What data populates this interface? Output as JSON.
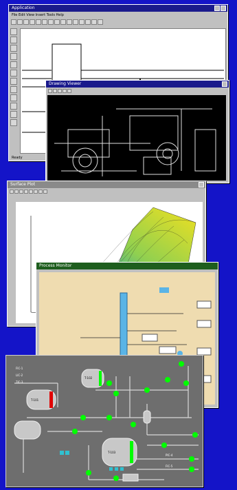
{
  "windows": {
    "ladder": {
      "title": "Application",
      "menu": "File Edit View Insert Tools Help",
      "status": "Ready"
    },
    "cad": {
      "title": "Drawing Viewer"
    },
    "plot3d": {
      "title": "Surface Plot"
    },
    "process": {
      "title": "Process Monitor"
    },
    "hmi": {
      "tanks": [
        "T-101",
        "T-102",
        "T-103"
      ],
      "tags": [
        "FIC-1",
        "LIC-2",
        "TIC-3",
        "PIC-4",
        "FIC-5"
      ]
    }
  },
  "colors": {
    "desktop": "#1414c8",
    "window_chrome": "#c0c0c0",
    "titlebar": "#1a1a8c",
    "cad_bg": "#000000",
    "process_bg": "#efdcb0",
    "hmi_bg": "#6e6e6e",
    "valve_green": "#00ff00",
    "alarm_red": "#e00000"
  }
}
